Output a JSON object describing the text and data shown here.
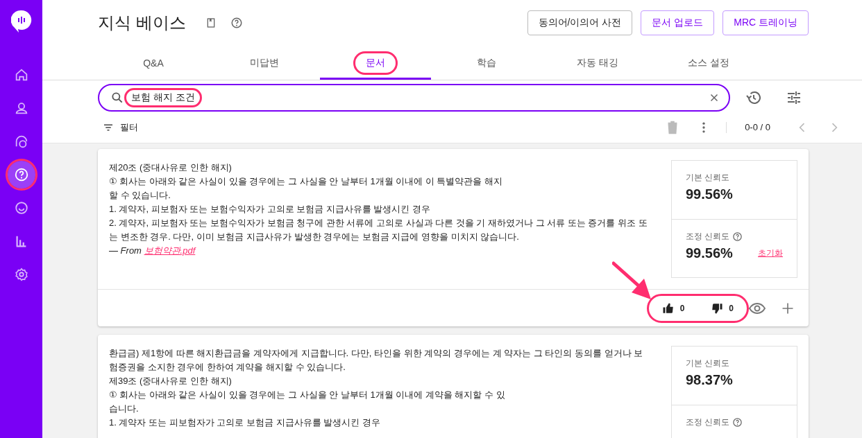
{
  "sidebar": {
    "items": [
      {
        "kind": "home",
        "selected": false,
        "highlighted": false
      },
      {
        "kind": "person",
        "selected": false,
        "highlighted": false
      },
      {
        "kind": "chat",
        "selected": false,
        "highlighted": false
      },
      {
        "kind": "help",
        "selected": true,
        "highlighted": true
      },
      {
        "kind": "qa",
        "selected": false,
        "highlighted": false
      },
      {
        "kind": "chart",
        "selected": false,
        "highlighted": false
      },
      {
        "kind": "settings",
        "selected": false,
        "highlighted": false
      }
    ]
  },
  "header": {
    "title": "지식 베이스",
    "buttons": [
      {
        "label": "동의어/이의어 사전",
        "kind": "neutral"
      },
      {
        "label": "문서 업로드",
        "kind": "primary"
      },
      {
        "label": "MRC 트레이닝",
        "kind": "primary"
      }
    ]
  },
  "tabs": [
    {
      "label": "Q&A",
      "selected": false,
      "highlighted": false
    },
    {
      "label": "미답변",
      "selected": false,
      "highlighted": false
    },
    {
      "label": "문서",
      "selected": true,
      "highlighted": true
    },
    {
      "label": "학습",
      "selected": false,
      "highlighted": false
    },
    {
      "label": "자동 태깅",
      "selected": false,
      "highlighted": false
    },
    {
      "label": "소스 설정",
      "selected": false,
      "highlighted": false
    }
  ],
  "search": {
    "value": "보험 해지 조건",
    "highlighted": true
  },
  "toolbar": {
    "filter_label": "필터",
    "pagination": "0-0 / 0"
  },
  "results": [
    {
      "lines": [
        "제20조 (중대사유로 인한 해지)",
        "① 회사는 아래와 같은 사실이 있을 경우에는 그 사실을 안 날부터 1개월 이내에 이 특별약관을 해지",
        "할 수 있습니다.",
        "1. 계약자, 피보험자 또는 보험수익자가 고의로 보험금 지급사유를 발생시킨 경우",
        "2. 계약자, 피보험자 또는 보험수익자가 보험금 청구에 관한 서류에 고의로 사실과 다른 것을 기 재하였거나 그 서류 또는 증거를 위조 또",
        "는 변조한 경우. 다만, 이미 보험금 지급사유가 발생한 경우에는 보험금 지급에 영향을 미치지 않습니다."
      ],
      "source_prefix": "— From",
      "source": "보험약관.pdf",
      "base_label": "기본 신뢰도",
      "base_value": "99.56%",
      "adjusted_label": "조정 신뢰도",
      "adjusted_value": "99.56%",
      "reset": "초기화",
      "likes": "0",
      "dislikes": "0",
      "feedback_highlighted": true
    },
    {
      "lines": [
        "환급금) 제1항에 따른 해지환급금을 계약자에게 지급합니다. 다만, 타인을 위한 계약의 경우에는 계 약자는 그 타인의 동의를 얻거나 보",
        "험증권을 소지한 경우에 한하여 계약을 해지할 수 있습니다.",
        "제39조 (중대사유로 인한 해지)",
        "① 회사는 아래와 같은 사실이 있을 경우에는 그 사실을 안 날부터 1개월 이내에 계약을 해지할 수 있",
        "습니다.",
        "1. 계약자 또는 피보험자가 고의로 보험금 지급사유를 발생시킨 경우"
      ],
      "base_label": "기본 신뢰도",
      "base_value": "98.37%",
      "adjusted_label": "조정 신뢰도"
    }
  ]
}
